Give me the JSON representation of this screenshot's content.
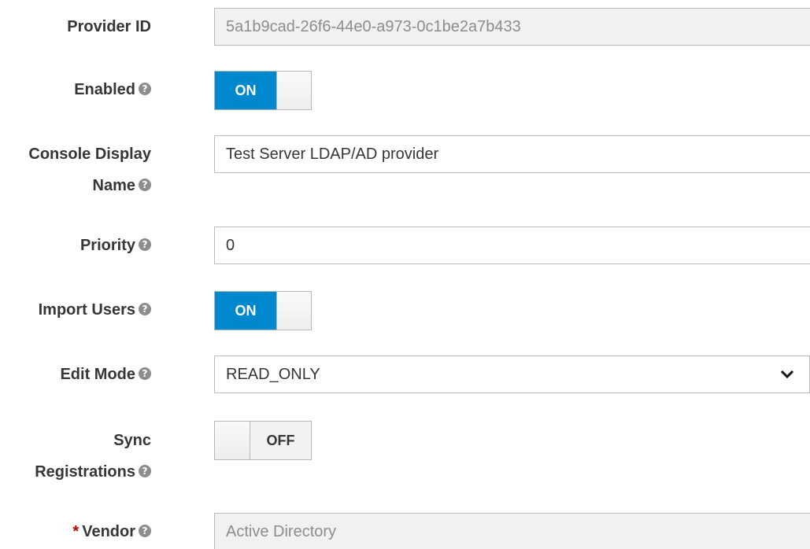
{
  "form": {
    "provider_id": {
      "label": "Provider ID",
      "value": "5a1b9cad-26f6-44e0-a973-0c1be2a7b433"
    },
    "enabled": {
      "label": "Enabled",
      "state": "ON"
    },
    "console_display_name": {
      "label_line1": "Console Display",
      "label_line2": "Name",
      "value": "Test Server LDAP/AD provider"
    },
    "priority": {
      "label": "Priority",
      "value": "0"
    },
    "import_users": {
      "label": "Import Users",
      "state": "ON"
    },
    "edit_mode": {
      "label": "Edit Mode",
      "value": "READ_ONLY"
    },
    "sync_registrations": {
      "label_line1": "Sync",
      "label_line2": "Registrations",
      "state": "OFF"
    },
    "vendor": {
      "required_marker": "*",
      "label": "Vendor",
      "value": "Active Directory"
    }
  },
  "icons": {
    "help": "question-circle-icon",
    "dropdown": "chevron-down-icon"
  },
  "colors": {
    "toggle_on": "#0088ce",
    "readonly_bg": "#f1f1f1",
    "required": "#c00000",
    "help_icon": "#8b8d8f"
  }
}
